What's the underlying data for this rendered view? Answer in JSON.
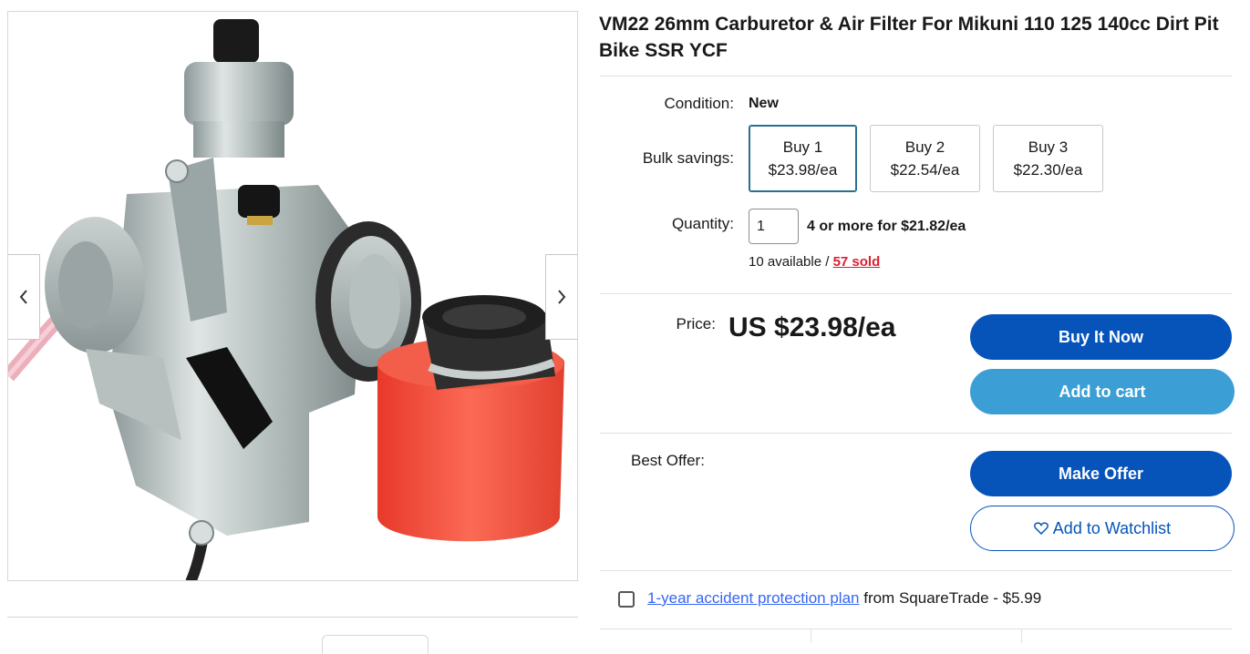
{
  "gallery": {
    "prev_icon": "chevron-left-icon",
    "next_icon": "chevron-right-icon"
  },
  "product": {
    "title": "VM22 26mm Carburetor & Air Filter For Mikuni 110 125 140cc Dirt Pit Bike SSR YCF"
  },
  "condition": {
    "label": "Condition:",
    "value": "New"
  },
  "bulk": {
    "label": "Bulk savings:",
    "options": [
      {
        "qty": "Buy 1",
        "price": "$23.98/ea",
        "selected": true
      },
      {
        "qty": "Buy 2",
        "price": "$22.54/ea",
        "selected": false
      },
      {
        "qty": "Buy 3",
        "price": "$22.30/ea",
        "selected": false
      }
    ]
  },
  "quantity": {
    "label": "Quantity:",
    "value": "1",
    "deal": "4 or more for $21.82/ea",
    "available": "10 available /",
    "sold": "57 sold"
  },
  "price": {
    "label": "Price:",
    "value": "US $23.98/ea"
  },
  "buttons": {
    "buy_now": "Buy It Now",
    "add_to_cart": "Add to cart",
    "make_offer": "Make Offer",
    "watchlist": "Add to Watchlist",
    "watchlist_icon": "heart-icon"
  },
  "offer": {
    "label": "Best Offer:"
  },
  "protection": {
    "link": "1-year accident protection plan",
    "text": "from SquareTrade - $5.99"
  },
  "colors": {
    "primary": "#0654ba",
    "secondary": "#3b9fd5",
    "link": "#3665f3",
    "sold": "#dd1e31"
  }
}
